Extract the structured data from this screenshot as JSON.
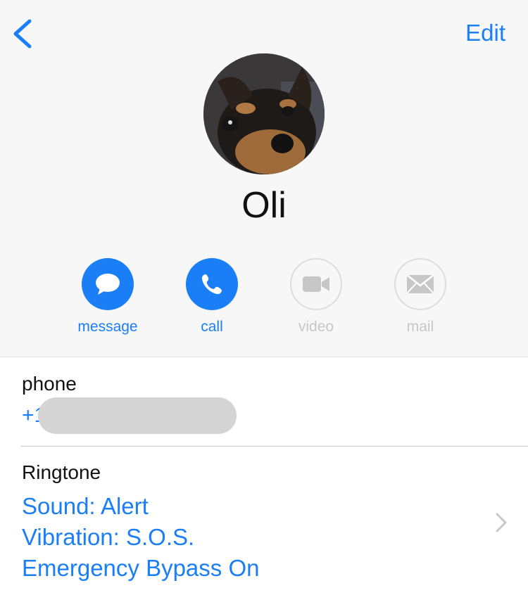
{
  "nav": {
    "back_icon": "chevron-left-icon",
    "edit_label": "Edit"
  },
  "contact": {
    "name": "Oli"
  },
  "actions": [
    {
      "label": "message",
      "icon": "message-bubble-icon",
      "enabled": true
    },
    {
      "label": "call",
      "icon": "phone-icon",
      "enabled": true
    },
    {
      "label": "video",
      "icon": "video-camera-icon",
      "enabled": false
    },
    {
      "label": "mail",
      "icon": "envelope-icon",
      "enabled": false
    }
  ],
  "phone": {
    "label": "phone",
    "number_visible": "+1"
  },
  "ringtone": {
    "label": "Ringtone",
    "sound": "Sound: Alert",
    "vibration": "Vibration: S.O.S.",
    "bypass": "Emergency Bypass On",
    "chevron_icon": "chevron-right-icon"
  },
  "colors": {
    "accent": "#1a7ef6",
    "inactive": "#c7c7c7",
    "header_bg": "#f7f7f7"
  }
}
